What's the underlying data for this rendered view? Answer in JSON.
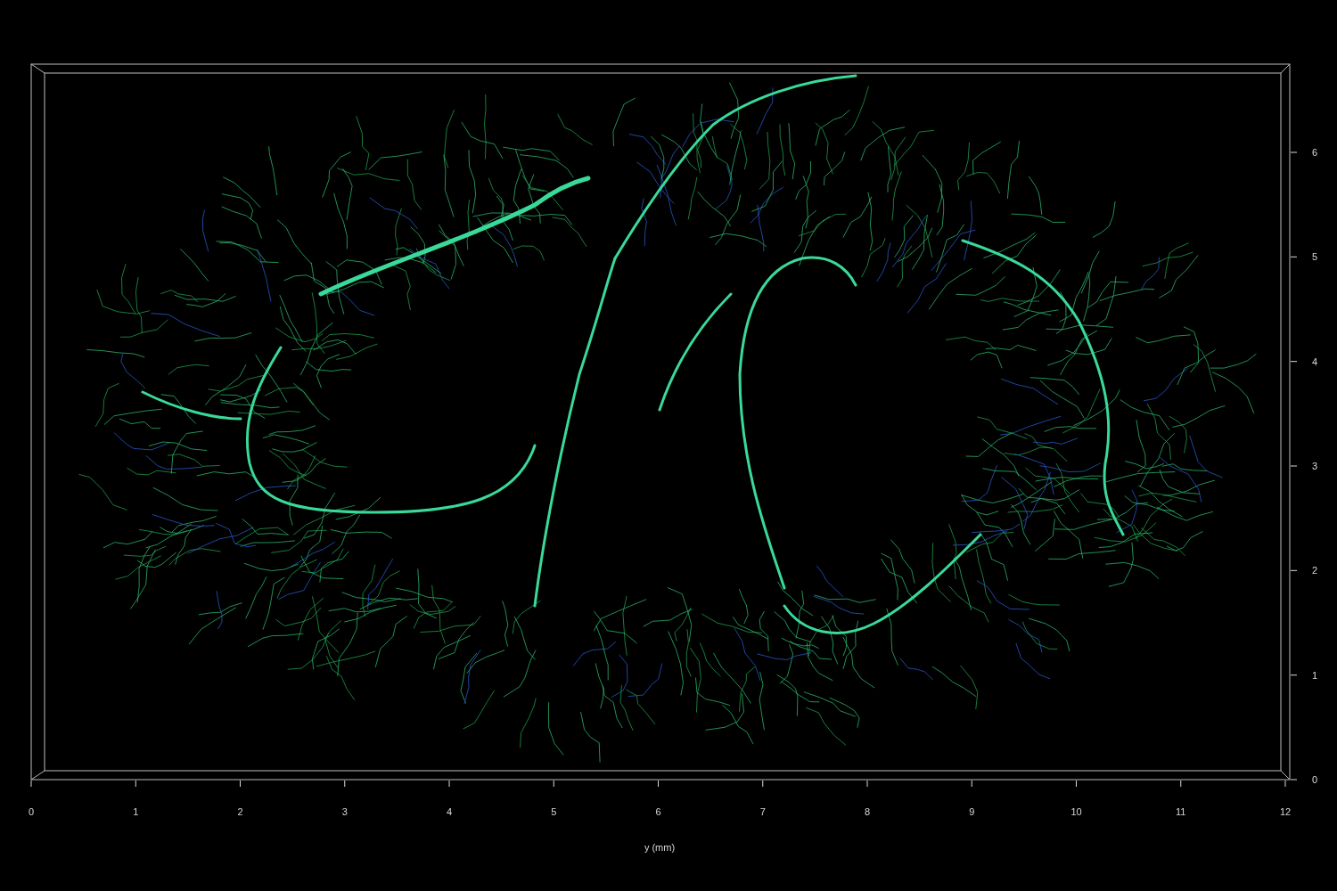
{
  "viewer": {
    "horizontal_axis": {
      "label": "y (mm)",
      "ticks": [
        "0",
        "1",
        "2",
        "3",
        "4",
        "5",
        "6",
        "7",
        "8",
        "9",
        "10",
        "11",
        "12"
      ]
    },
    "vertical_axis": {
      "ticks": [
        "6",
        "5",
        "4",
        "3",
        "2",
        "1",
        "0"
      ]
    }
  }
}
